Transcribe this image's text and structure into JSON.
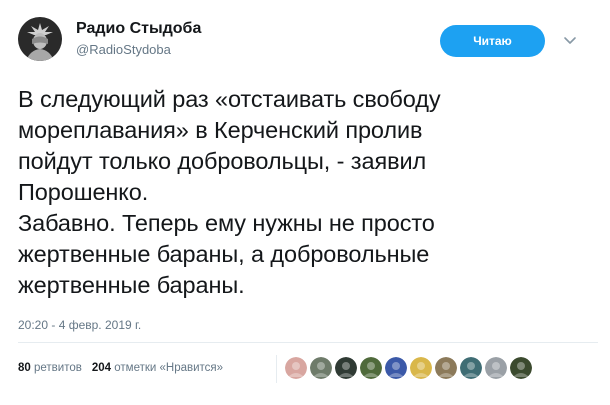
{
  "author": {
    "name": "Радио Стыдоба",
    "handle": "@RadioStydoba"
  },
  "follow_button_label": "Читаю",
  "tweet": {
    "text": "В следующий раз «отстаивать свободу\nмореплавания» в Керченский пролив\nпойдут только добровольцы, - заявил\nПорошенко.\nЗабавно. Теперь ему нужны не просто\nжертвенные бараны, а добровольные\nжертвенные бараны.",
    "timestamp": "20:20 - 4 февр. 2019 г."
  },
  "stats": {
    "retweets_count": "80",
    "retweets_label": "ретвитов",
    "likes_count": "204",
    "likes_label": "отметки «Нравится»"
  },
  "likers": [
    {
      "icon": "liker-avatar",
      "color": "#d8a6a0"
    },
    {
      "icon": "liker-avatar",
      "color": "#6e7b6a"
    },
    {
      "icon": "liker-avatar",
      "color": "#2f3a34"
    },
    {
      "icon": "liker-avatar",
      "color": "#4f6a3b"
    },
    {
      "icon": "liker-avatar",
      "color": "#3b59a8"
    },
    {
      "icon": "liker-avatar",
      "color": "#d9b74a"
    },
    {
      "icon": "liker-avatar",
      "color": "#8c7a5a"
    },
    {
      "icon": "liker-avatar",
      "color": "#3f6d74"
    },
    {
      "icon": "liker-avatar",
      "color": "#9aa0a6"
    },
    {
      "icon": "liker-avatar",
      "color": "#3b4a2e"
    }
  ],
  "colors": {
    "accent": "#1da1f2",
    "text": "#14171a",
    "muted": "#657786",
    "divider": "#e6ecf0"
  }
}
